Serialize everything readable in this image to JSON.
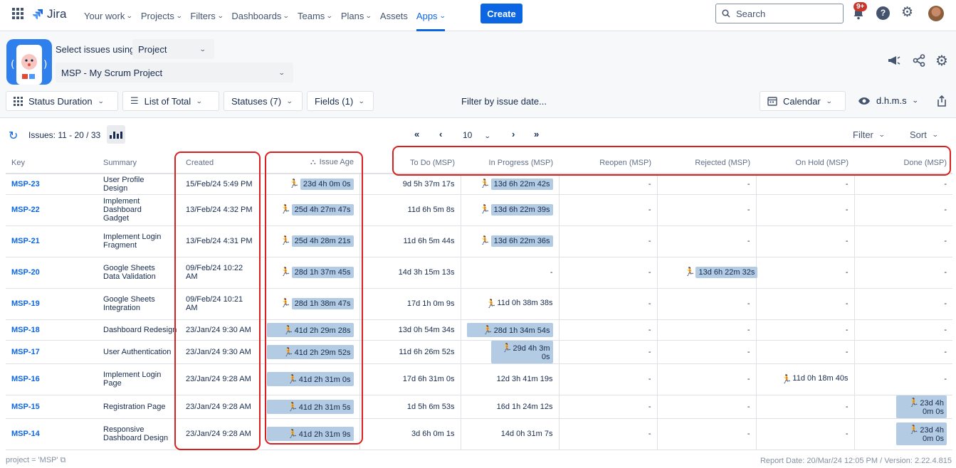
{
  "topnav": {
    "logo": "Jira",
    "items": [
      {
        "label": "Your work"
      },
      {
        "label": "Projects"
      },
      {
        "label": "Filters"
      },
      {
        "label": "Dashboards"
      },
      {
        "label": "Teams"
      },
      {
        "label": "Plans"
      },
      {
        "label": "Assets"
      },
      {
        "label": "Apps",
        "active": true
      }
    ],
    "create_label": "Create",
    "search_placeholder": "Search",
    "notification_badge": "9+"
  },
  "header": {
    "select_label": "Select issues using",
    "select_type": "Project",
    "project": "MSP - My Scrum Project"
  },
  "toolbar": {
    "view": "Status Duration",
    "mode": "List of Total",
    "statuses": "Statuses (7)",
    "fields": "Fields (1)",
    "filter_date": "Filter by issue date...",
    "calendar": "Calendar",
    "time_format": "d.h.m.s"
  },
  "pagination": {
    "issues": "Issues: 11 - 20 / 33",
    "page_size": "10",
    "filter": "Filter",
    "sort": "Sort"
  },
  "table": {
    "headers": [
      "Key",
      "Summary",
      "Created",
      "Issue Age",
      "To Do (MSP)",
      "In Progress (MSP)",
      "Reopen (MSP)",
      "Rejected (MSP)",
      "On Hold (MSP)",
      "Done (MSP)"
    ],
    "rows": [
      {
        "key": "MSP-23",
        "summary": "User Profile Design",
        "created": "15/Feb/24 5:49 PM",
        "age": "23d 4h 0m 0s",
        "todo": "9d 5h 37m 17s",
        "inprog": "13d 6h 22m 42s",
        "reopen": "-",
        "rejected": "-",
        "onhold": "-",
        "done": "-"
      },
      {
        "key": "MSP-22",
        "summary": "Implement Dashboard Gadget",
        "created": "13/Feb/24 4:32 PM",
        "age": "25d 4h 27m 47s",
        "todo": "11d 6h 5m 8s",
        "inprog": "13d 6h 22m 39s",
        "reopen": "-",
        "rejected": "-",
        "onhold": "-",
        "done": "-"
      },
      {
        "key": "MSP-21",
        "summary": "Implement Login Fragment",
        "created": "13/Feb/24 4:31 PM",
        "age": "25d 4h 28m 21s",
        "todo": "11d 6h 5m 44s",
        "inprog": "13d 6h 22m 36s",
        "reopen": "-",
        "rejected": "-",
        "onhold": "-",
        "done": "-"
      },
      {
        "key": "MSP-20",
        "summary": "Google Sheets Data Validation",
        "created": "09/Feb/24 10:22 AM",
        "age": "28d 1h 37m 45s",
        "todo": "14d 3h 15m 13s",
        "inprog": "-",
        "reopen": "-",
        "rejected": "13d 6h 22m 32s",
        "onhold": "-",
        "done": "-"
      },
      {
        "key": "MSP-19",
        "summary": "Google Sheets Integration",
        "created": "09/Feb/24 10:21 AM",
        "age": "28d 1h 38m 47s",
        "todo": "17d 1h 0m 9s",
        "inprog": "11d 0h 38m 38s",
        "reopen": "-",
        "rejected": "-",
        "onhold": "-",
        "done": "-"
      },
      {
        "key": "MSP-18",
        "summary": "Dashboard Redesign",
        "created": "23/Jan/24 9:30 AM",
        "age": "41d 2h 29m 28s",
        "todo": "13d 0h 54m 34s",
        "inprog": "28d 1h 34m 54s",
        "reopen": "-",
        "rejected": "-",
        "onhold": "-",
        "done": "-"
      },
      {
        "key": "MSP-17",
        "summary": "User Authentication",
        "created": "23/Jan/24 9:30 AM",
        "age": "41d 2h 29m 52s",
        "todo": "11d 6h 26m 52s",
        "inprog": "29d 4h 3m 0s",
        "reopen": "-",
        "rejected": "-",
        "onhold": "-",
        "done": "-"
      },
      {
        "key": "MSP-16",
        "summary": "Implement Login Page",
        "created": "23/Jan/24 9:28 AM",
        "age": "41d 2h 31m 0s",
        "todo": "17d 6h 31m 0s",
        "inprog": "12d 3h 41m 19s",
        "reopen": "-",
        "rejected": "-",
        "onhold": "11d 0h 18m 40s",
        "done": "-"
      },
      {
        "key": "MSP-15",
        "summary": "Registration Page",
        "created": "23/Jan/24 9:28 AM",
        "age": "41d 2h 31m 5s",
        "todo": "1d 5h 6m 53s",
        "inprog": "16d 1h 24m 12s",
        "reopen": "-",
        "rejected": "-",
        "onhold": "-",
        "done": "23d 4h 0m 0s"
      },
      {
        "key": "MSP-14",
        "summary": "Responsive Dashboard Design",
        "created": "23/Jan/24 9:28 AM",
        "age": "41d 2h 31m 9s",
        "todo": "3d 6h 0m 1s",
        "inprog": "14d 0h 31m 7s",
        "reopen": "-",
        "rejected": "-",
        "onhold": "-",
        "done": "23d 4h 0m 0s"
      }
    ]
  },
  "footer": {
    "jql": "project = 'MSP'",
    "report": "Report Date: 20/Mar/24 12:05 PM / Version: 2.22.4.815"
  },
  "colors": {
    "brand": "#0c66e4",
    "highlight": "#b3cbe3",
    "annotation": "#d92020"
  }
}
